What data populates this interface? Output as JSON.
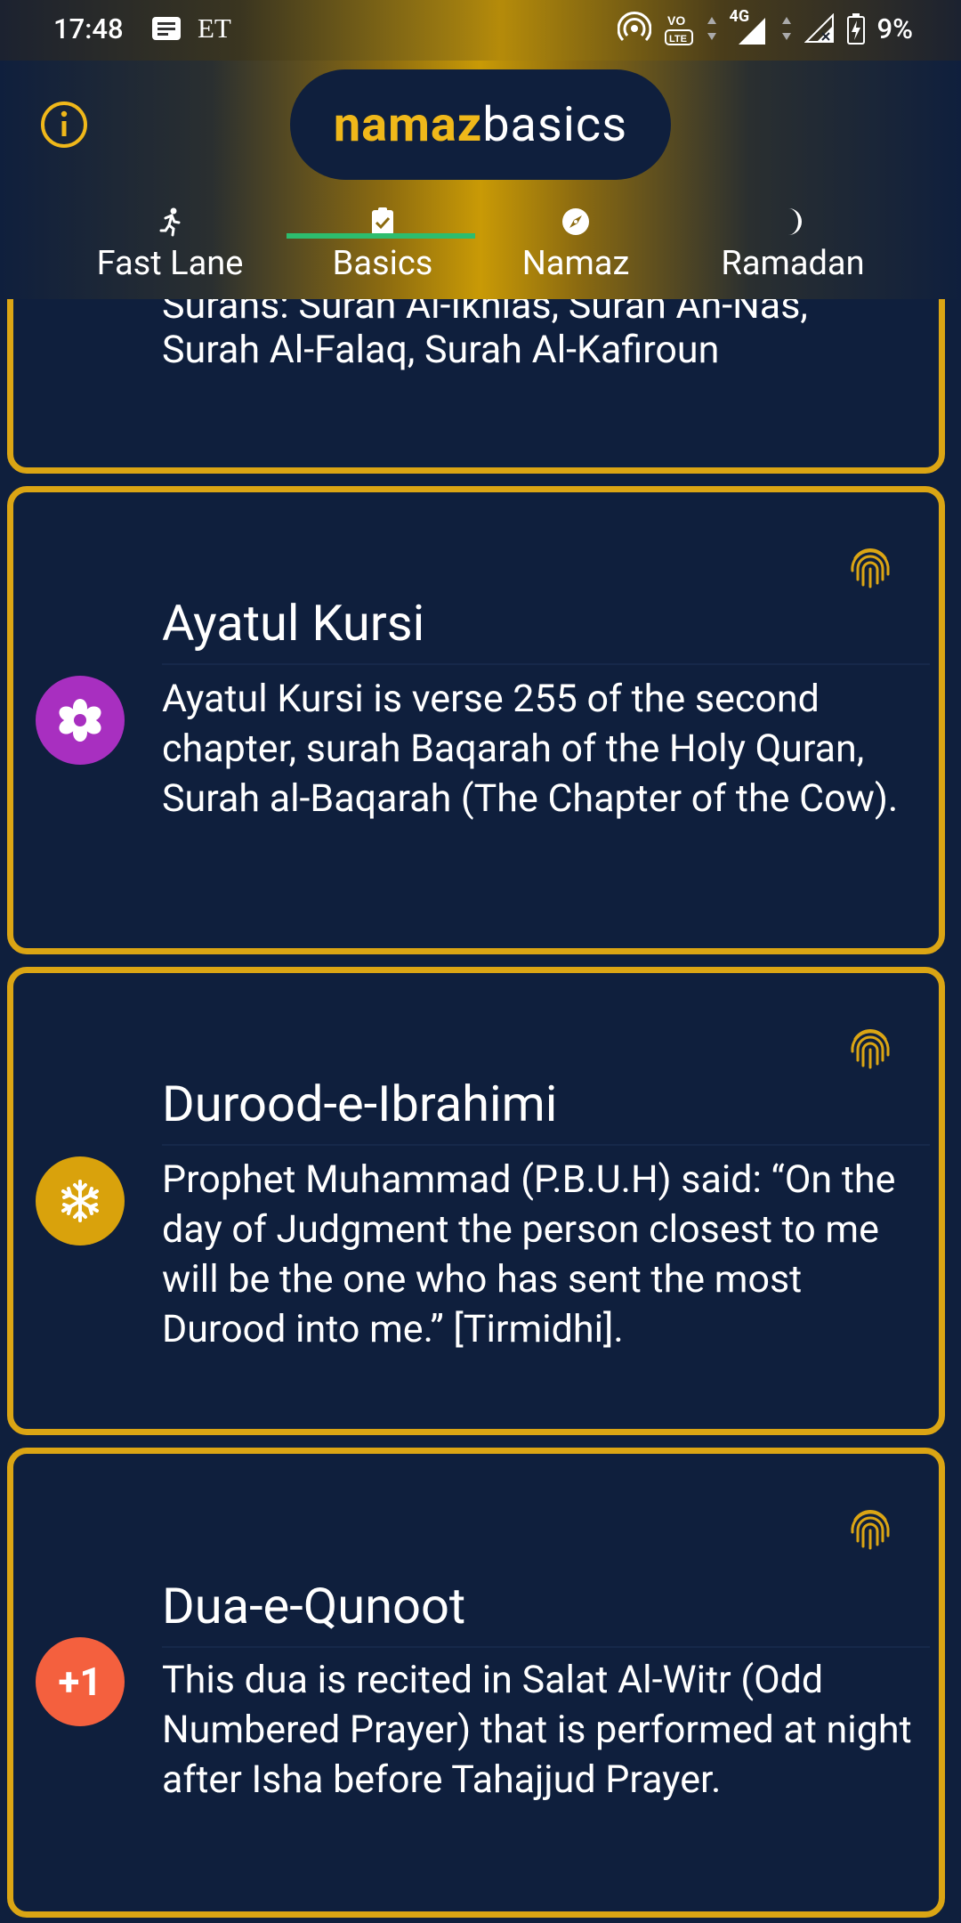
{
  "status_bar": {
    "time": "17:48",
    "carrier": "ET",
    "network": "4G",
    "battery": "9%"
  },
  "header": {
    "logo_part1": "namaz",
    "logo_part2": "basics",
    "info_icon": "info-icon"
  },
  "tabs": [
    {
      "label": "Fast Lane",
      "icon": "running-person-icon"
    },
    {
      "label": "Basics",
      "icon": "clipboard-check-icon",
      "selected": true
    },
    {
      "label": "Namaz",
      "icon": "compass-icon"
    },
    {
      "label": "Ramadan",
      "icon": "crescent-moon-icon"
    }
  ],
  "cards": [
    {
      "partial_title": "Surahs: Surah Al-Ikhlas, Surah An-Nas,",
      "body": "Surah Al-Falaq, Surah Al-Kafiroun"
    },
    {
      "title": "Ayatul Kursi",
      "body": "Ayatul Kursi is verse 255 of the second chapter, surah Baqarah of the Holy Quran, Surah al-Baqarah (The Chapter of the Cow).",
      "badge_icon": "flower-icon",
      "badge_color": "#a82fc0"
    },
    {
      "title": "Durood-e-Ibrahimi",
      "body": "Prophet Muhammad (P.B.U.H) said: “On the day of Judgment the person closest to me will be the one who has sent the most Durood into me.” [Tirmidhi].",
      "badge_icon": "snowflake-icon",
      "badge_color": "#d9a20c"
    },
    {
      "title": "Dua-e-Qunoot",
      "body": "This dua is recited in Salat Al-Witr (Odd Numbered Prayer) that is performed at night after Isha before Tahajjud Prayer.",
      "badge_text": "+1",
      "badge_color": "#f4603e"
    }
  ],
  "colors": {
    "background": "#0f1f3d",
    "card_border": "#dba514",
    "accent_gold": "#f0b81a",
    "tab_indicator": "#2dbd6e",
    "fingerprint": "#dba514"
  }
}
